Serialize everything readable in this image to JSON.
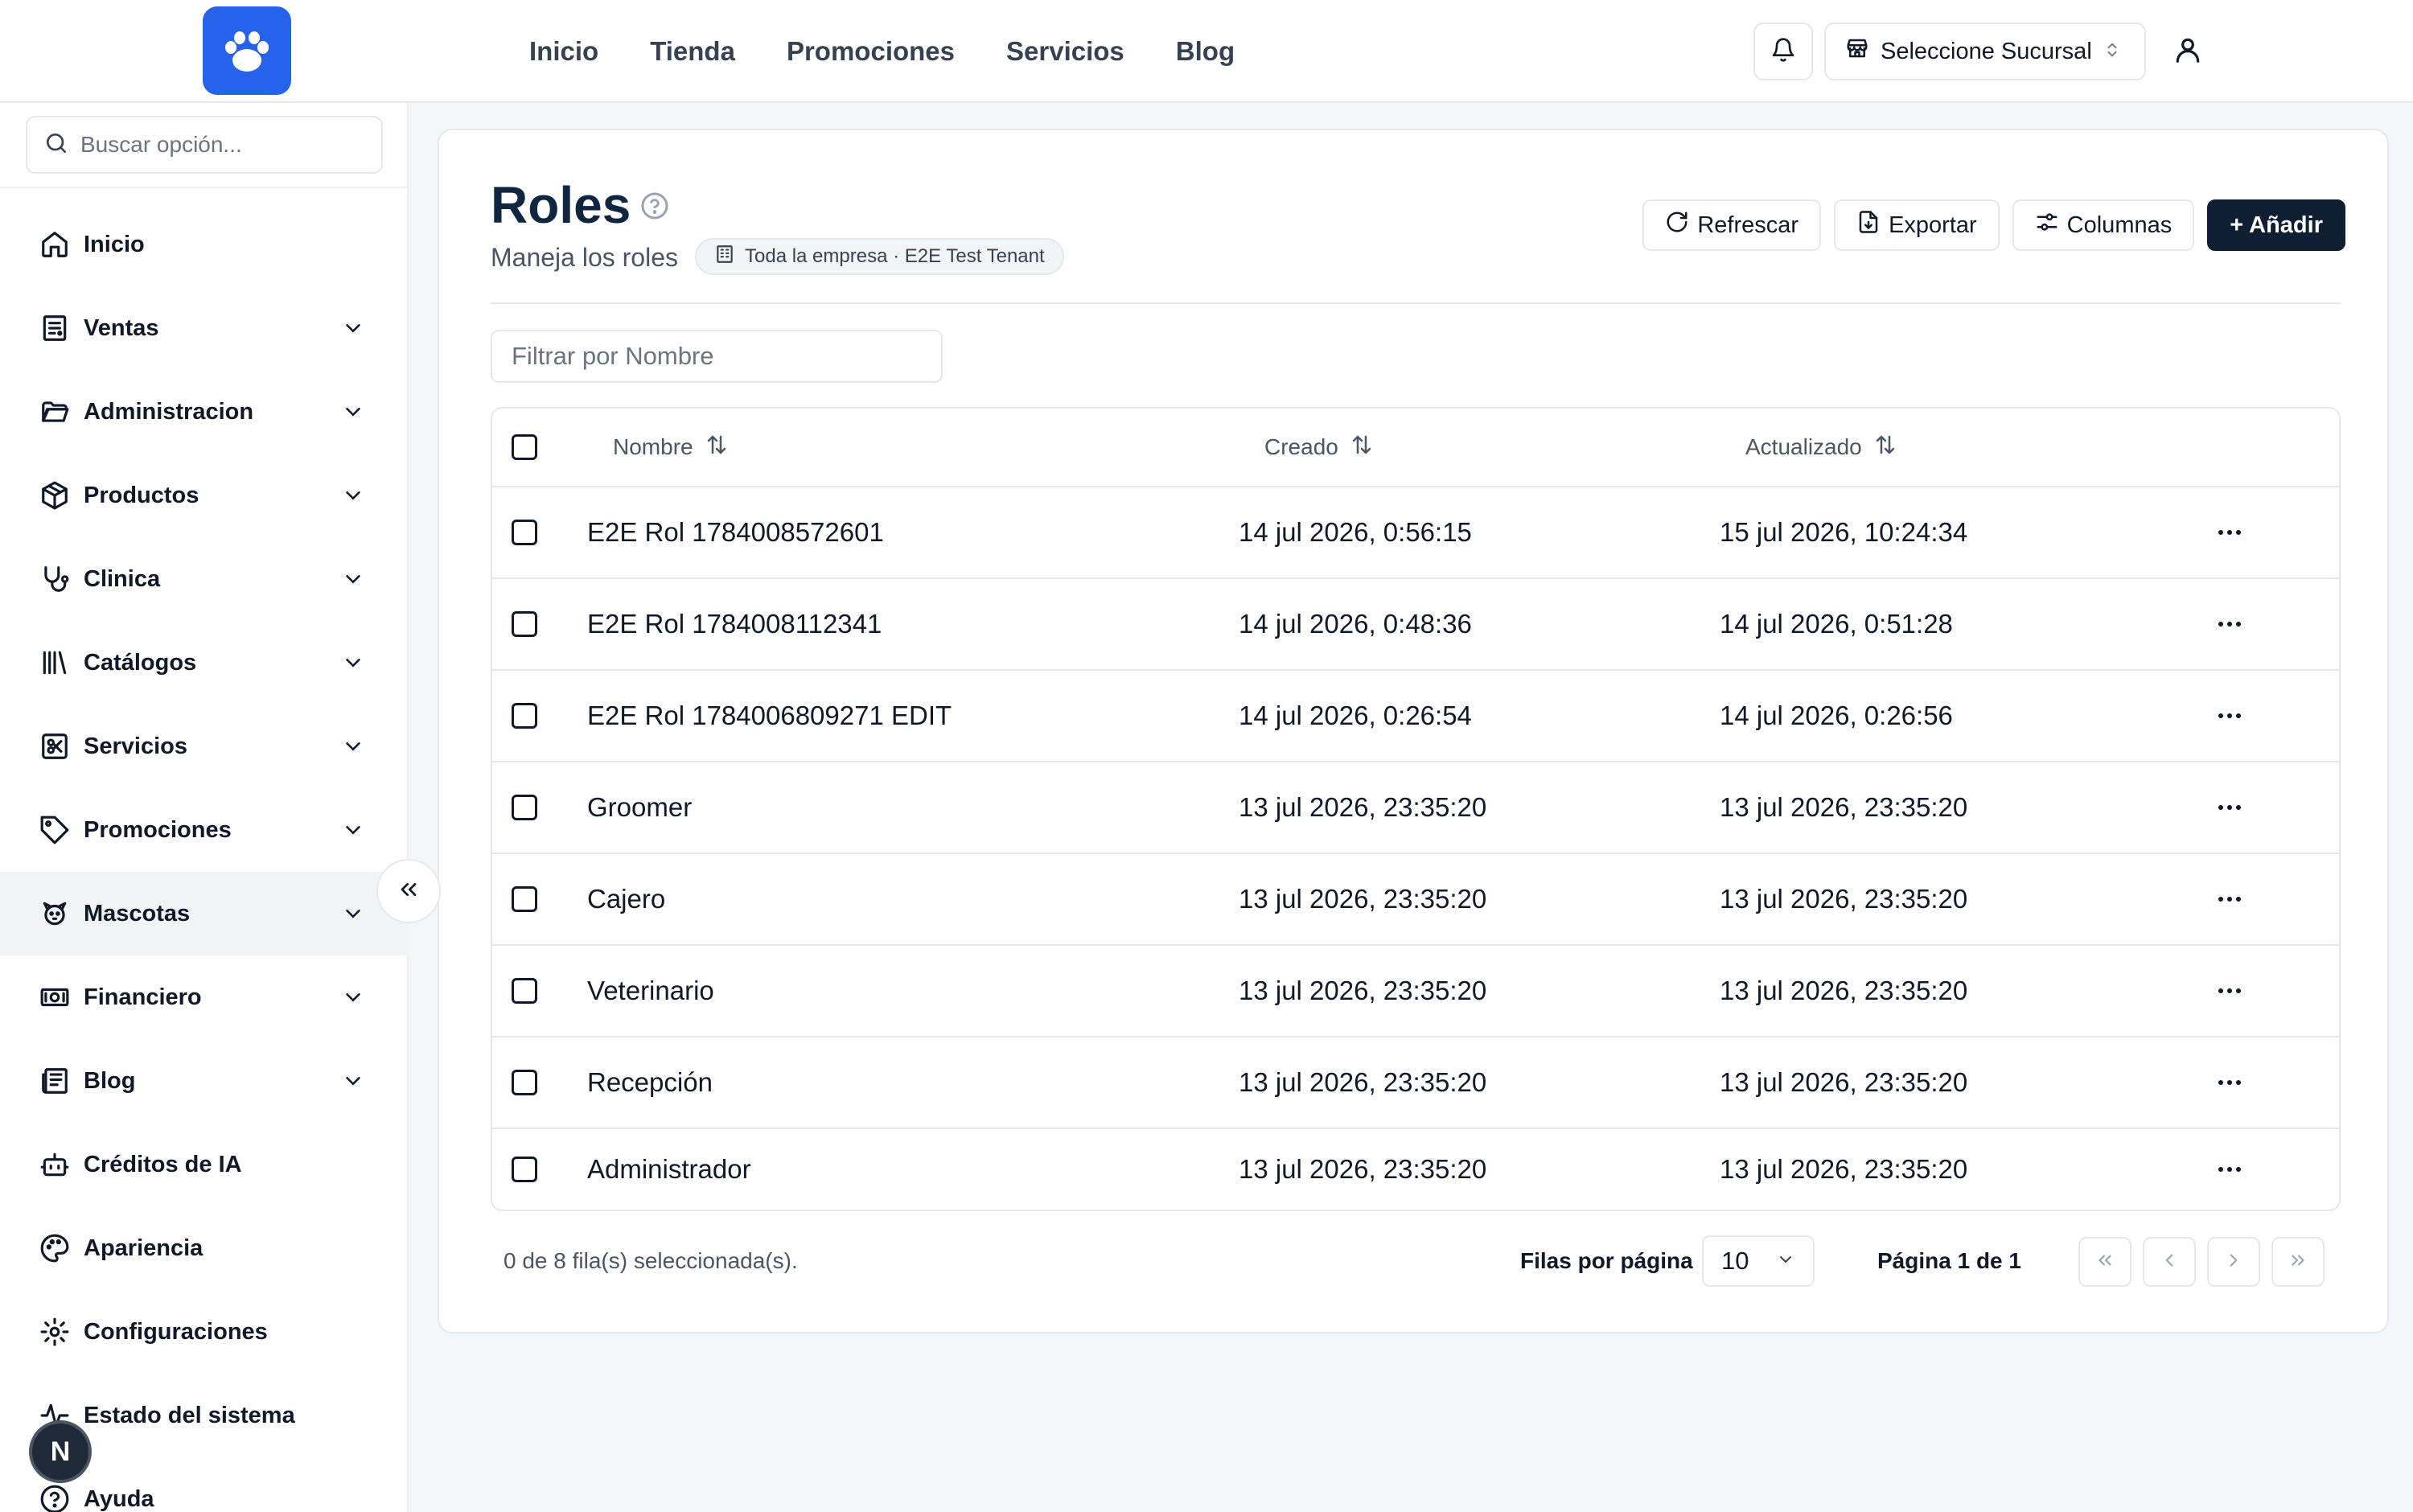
{
  "topbar": {
    "nav": [
      "Inicio",
      "Tienda",
      "Promociones",
      "Servicios",
      "Blog"
    ],
    "branch_label": "Seleccione Sucursal"
  },
  "sidebar": {
    "search_placeholder": "Buscar opción...",
    "items": [
      {
        "label": "Inicio",
        "icon": "home-icon",
        "expandable": false
      },
      {
        "label": "Ventas",
        "icon": "receipt-icon",
        "expandable": true
      },
      {
        "label": "Administracion",
        "icon": "folder-open-icon",
        "expandable": true
      },
      {
        "label": "Productos",
        "icon": "package-icon",
        "expandable": true
      },
      {
        "label": "Clinica",
        "icon": "stethoscope-icon",
        "expandable": true
      },
      {
        "label": "Catálogos",
        "icon": "library-icon",
        "expandable": true
      },
      {
        "label": "Servicios",
        "icon": "scissors-square-icon",
        "expandable": true
      },
      {
        "label": "Promociones",
        "icon": "tag-icon",
        "expandable": true
      },
      {
        "label": "Mascotas",
        "icon": "dog-icon",
        "expandable": true,
        "active": true
      },
      {
        "label": "Financiero",
        "icon": "banknote-icon",
        "expandable": true
      },
      {
        "label": "Blog",
        "icon": "newspaper-icon",
        "expandable": true
      },
      {
        "label": "Créditos de IA",
        "icon": "bot-icon",
        "expandable": false
      },
      {
        "label": "Apariencia",
        "icon": "palette-icon",
        "expandable": false
      },
      {
        "label": "Configuraciones",
        "icon": "settings-icon",
        "expandable": false
      },
      {
        "label": "Estado del sistema",
        "icon": "activity-icon",
        "expandable": false
      },
      {
        "label": "Ayuda",
        "icon": "help-circle-icon",
        "expandable": false
      }
    ],
    "dev_badge": "N"
  },
  "page": {
    "title": "Roles",
    "subtitle": "Maneja los roles",
    "scope_badge": "Toda la empresa · E2E Test Tenant",
    "actions": {
      "refresh": "Refrescar",
      "export": "Exportar",
      "columns": "Columnas",
      "add": "+ Añadir"
    },
    "filter_placeholder": "Filtrar por Nombre"
  },
  "table": {
    "columns": [
      "Nombre",
      "Creado",
      "Actualizado"
    ],
    "rows": [
      {
        "name": "E2E Rol 1784008572601",
        "created": "14 jul 2026, 0:56:15",
        "updated": "15 jul 2026, 10:24:34"
      },
      {
        "name": "E2E Rol 1784008112341",
        "created": "14 jul 2026, 0:48:36",
        "updated": "14 jul 2026, 0:51:28"
      },
      {
        "name": "E2E Rol 1784006809271 EDIT",
        "created": "14 jul 2026, 0:26:54",
        "updated": "14 jul 2026, 0:26:56"
      },
      {
        "name": "Groomer",
        "created": "13 jul 2026, 23:35:20",
        "updated": "13 jul 2026, 23:35:20"
      },
      {
        "name": "Cajero",
        "created": "13 jul 2026, 23:35:20",
        "updated": "13 jul 2026, 23:35:20"
      },
      {
        "name": "Veterinario",
        "created": "13 jul 2026, 23:35:20",
        "updated": "13 jul 2026, 23:35:20"
      },
      {
        "name": "Recepción",
        "created": "13 jul 2026, 23:35:20",
        "updated": "13 jul 2026, 23:35:20"
      },
      {
        "name": "Administrador",
        "created": "13 jul 2026, 23:35:20",
        "updated": "13 jul 2026, 23:35:20"
      }
    ]
  },
  "footer": {
    "selection": "0 de 8 fila(s) seleccionada(s).",
    "rows_per_page_label": "Filas por página",
    "rows_per_page": "10",
    "page_info": "Página 1 de 1"
  },
  "colors": {
    "brand": "#2563eb",
    "primary_button": "#0f1e33",
    "title": "#0f2540"
  }
}
